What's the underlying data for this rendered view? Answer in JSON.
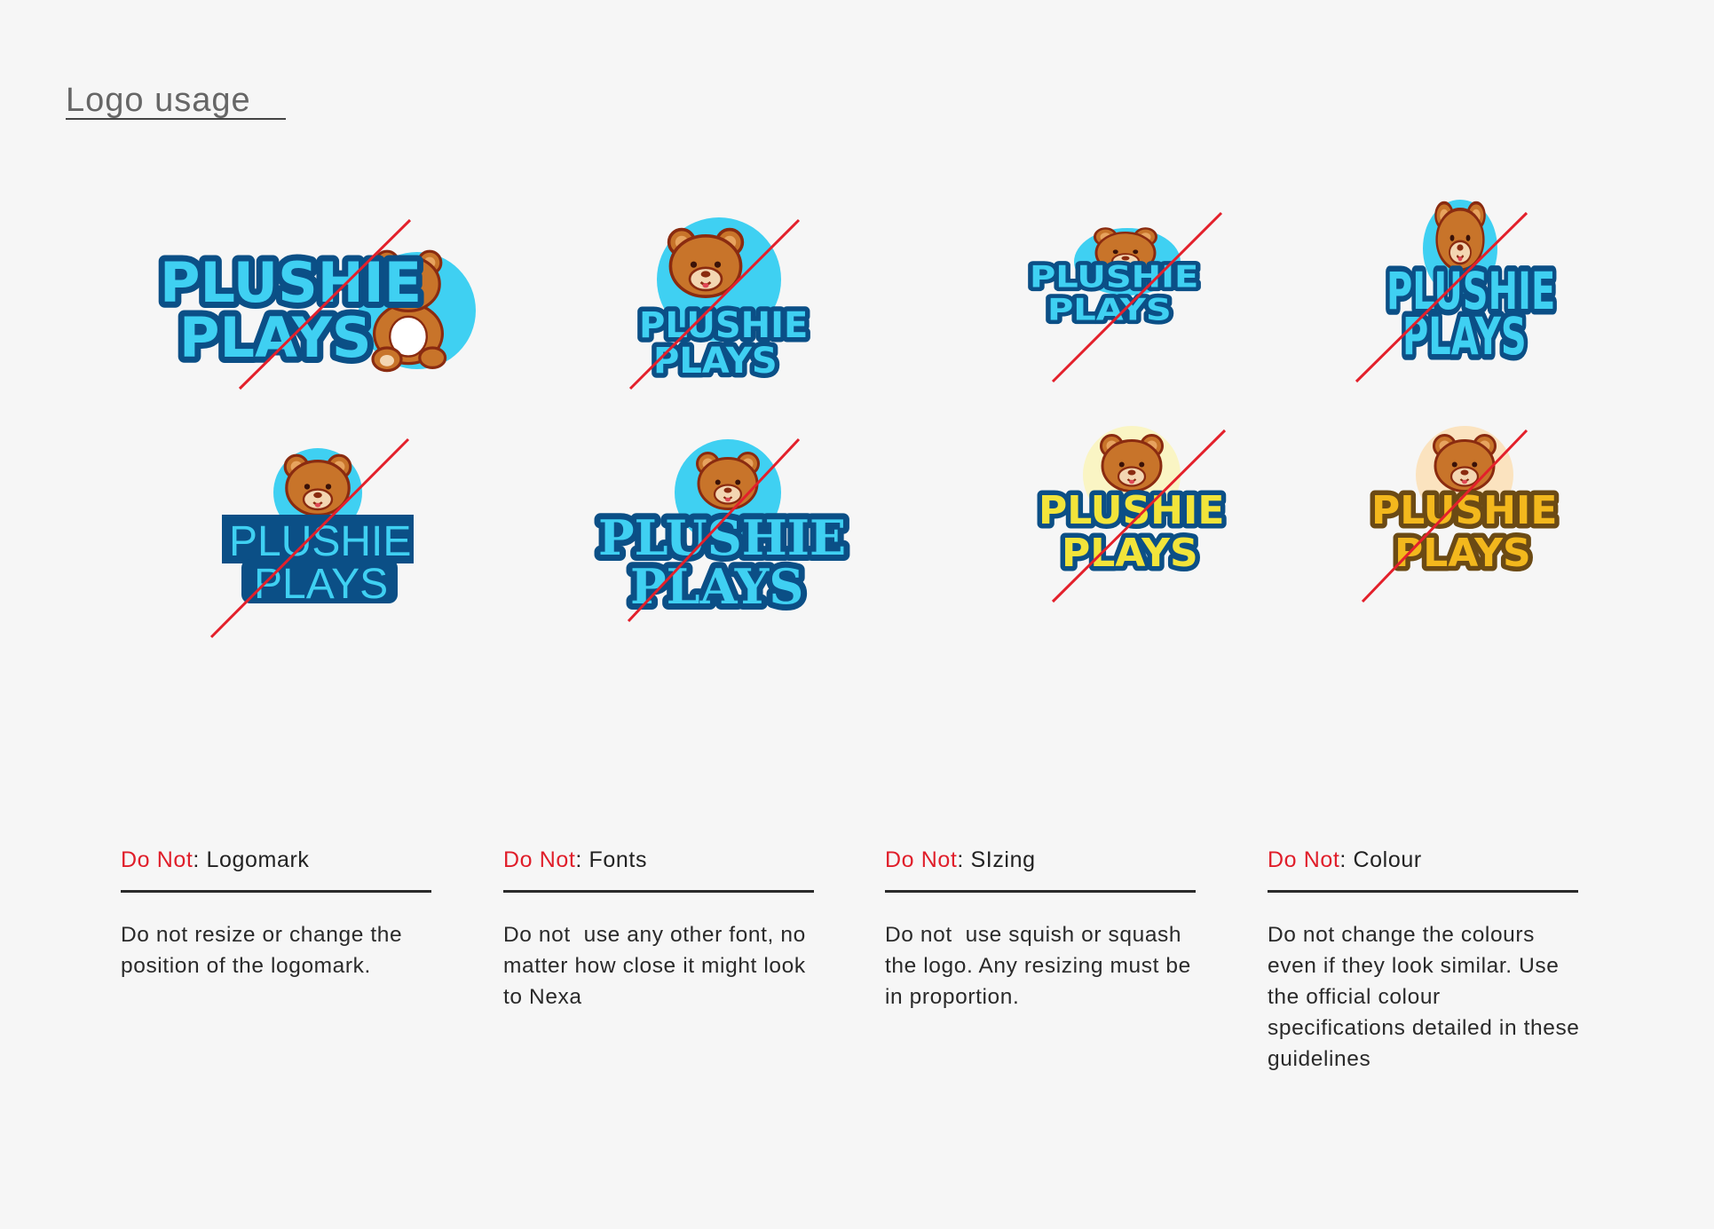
{
  "page": {
    "title": "Logo usage"
  },
  "logo": {
    "line1": "PLUSHIE",
    "line2": "PLAYS",
    "mascot_icon": "teddy-bear-icon",
    "colors": {
      "primary_text": "#3fd0f2",
      "text_outline": "#0b4f86",
      "navy_box": "#0b4f86",
      "yellow_text": "#f2e43a",
      "gold_text": "#f3b81d",
      "gold_outline": "#6b4a14",
      "bear_brown": "#c8742a",
      "bear_outline": "#8a2b10",
      "sun_blue": "#3fd0f2",
      "slash_red": "#e3202b"
    }
  },
  "rules": [
    {
      "prefix": "Do Not",
      "topic": ": Logomark",
      "desc": "Do not resize or change the position of the logomark."
    },
    {
      "prefix": "Do Not",
      "topic": ": Fonts",
      "desc": "Do not  use any other font, no matter how close it might look to Nexa"
    },
    {
      "prefix": "Do Not",
      "topic": ": SIzing",
      "desc": "Do not  use squish or squash the logo. Any resizing must be in proportion."
    },
    {
      "prefix": "Do Not",
      "topic": ": Colour",
      "desc": "Do not change the colours even if they look similar. Use the official colour specifications detailed in these guidelines"
    }
  ]
}
